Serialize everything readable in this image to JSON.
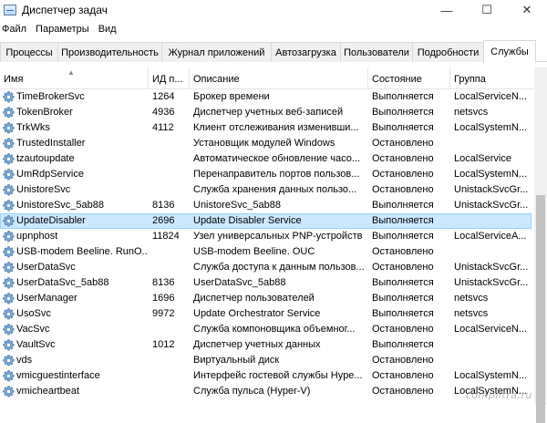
{
  "window": {
    "title": "Диспетчер задач",
    "minimize": "—",
    "maximize": "☐",
    "close": "✕"
  },
  "menu": [
    "Файл",
    "Параметры",
    "Вид"
  ],
  "tabs": [
    {
      "label": "Процессы"
    },
    {
      "label": "Производительность"
    },
    {
      "label": "Журнал приложений"
    },
    {
      "label": "Автозагрузка"
    },
    {
      "label": "Пользователи"
    },
    {
      "label": "Подробности"
    },
    {
      "label": "Службы",
      "active": true
    }
  ],
  "columns": {
    "name": "Имя",
    "pid": "ИД п...",
    "description": "Описание",
    "status": "Состояние",
    "group": "Группа"
  },
  "rows": [
    {
      "name": "TimeBrokerSvc",
      "pid": "1264",
      "description": "Брокер времени",
      "status": "Выполняется",
      "group": "LocalServiceN..."
    },
    {
      "name": "TokenBroker",
      "pid": "4936",
      "description": "Диспетчер учетных веб-записей",
      "status": "Выполняется",
      "group": "netsvcs"
    },
    {
      "name": "TrkWks",
      "pid": "4112",
      "description": "Клиент отслеживания изменивши...",
      "status": "Выполняется",
      "group": "LocalSystemN..."
    },
    {
      "name": "TrustedInstaller",
      "pid": "",
      "description": "Установщик модулей Windows",
      "status": "Остановлено",
      "group": ""
    },
    {
      "name": "tzautoupdate",
      "pid": "",
      "description": "Автоматическое обновление часо...",
      "status": "Остановлено",
      "group": "LocalService"
    },
    {
      "name": "UmRdpService",
      "pid": "",
      "description": "Перенаправитель портов пользов...",
      "status": "Остановлено",
      "group": "LocalSystemN..."
    },
    {
      "name": "UnistoreSvc",
      "pid": "",
      "description": "Служба хранения данных пользо...",
      "status": "Остановлено",
      "group": "UnistackSvcGr..."
    },
    {
      "name": "UnistoreSvc_5ab88",
      "pid": "8136",
      "description": "UnistoreSvc_5ab88",
      "status": "Выполняется",
      "group": "UnistackSvcGr..."
    },
    {
      "name": "UpdateDisabler",
      "pid": "2696",
      "description": "Update Disabler Service",
      "status": "Выполняется",
      "group": "",
      "selected": true
    },
    {
      "name": "upnphost",
      "pid": "11824",
      "description": "Узел универсальных PNP-устройств",
      "status": "Выполняется",
      "group": "LocalServiceA..."
    },
    {
      "name": "USB-modem Beeline. RunO...",
      "pid": "",
      "description": "USB-modem Beeline. OUC",
      "status": "Остановлено",
      "group": ""
    },
    {
      "name": "UserDataSvc",
      "pid": "",
      "description": "Служба доступа к данным пользов...",
      "status": "Остановлено",
      "group": "UnistackSvcGr..."
    },
    {
      "name": "UserDataSvc_5ab88",
      "pid": "8136",
      "description": "UserDataSvc_5ab88",
      "status": "Выполняется",
      "group": "UnistackSvcGr..."
    },
    {
      "name": "UserManager",
      "pid": "1696",
      "description": "Диспетчер пользователей",
      "status": "Выполняется",
      "group": "netsvcs"
    },
    {
      "name": "UsoSvc",
      "pid": "9972",
      "description": "Update Orchestrator Service",
      "status": "Выполняется",
      "group": "netsvcs"
    },
    {
      "name": "VacSvc",
      "pid": "",
      "description": "Служба компоновщика объемног...",
      "status": "Остановлено",
      "group": "LocalServiceN..."
    },
    {
      "name": "VaultSvc",
      "pid": "1012",
      "description": "Диспетчер учетных данных",
      "status": "Выполняется",
      "group": ""
    },
    {
      "name": "vds",
      "pid": "",
      "description": "Виртуальный диск",
      "status": "Остановлено",
      "group": ""
    },
    {
      "name": "vmicguestinterface",
      "pid": "",
      "description": "Интерфейс гостевой службы Hype...",
      "status": "Остановлено",
      "group": "LocalSystemN..."
    },
    {
      "name": "vmicheartbeat",
      "pid": "",
      "description": "Служба пульса (Hyper-V)",
      "status": "Остановлено",
      "group": "LocalSystemN..."
    }
  ],
  "watermark": "compiltra.ru",
  "colors": {
    "selected_bg": "#cce8ff",
    "selected_border": "#99d1ff",
    "grid_line": "#e5e5e5"
  }
}
